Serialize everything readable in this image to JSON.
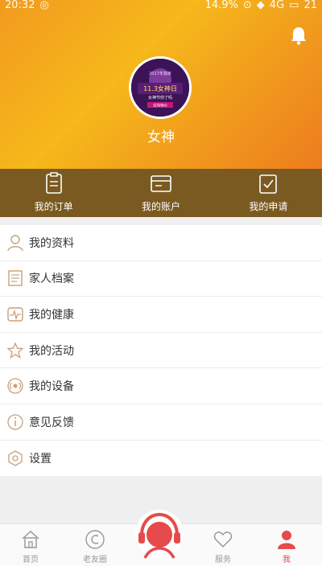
{
  "status_bar": {
    "time": "20:32",
    "battery_text": "14.9%",
    "signal": "4G",
    "level": "21"
  },
  "profile": {
    "name": "女神"
  },
  "avatar_text": {
    "line1": "2017年独家",
    "line2": "11.3女神日",
    "line3": "女神节你了吗",
    "line4": "全场特价"
  },
  "quick_actions": [
    {
      "label": "我的订单"
    },
    {
      "label": "我的账户"
    },
    {
      "label": "我的申请"
    }
  ],
  "menu": [
    {
      "label": "我的资料",
      "icon": "person-icon"
    },
    {
      "label": "家人档案",
      "icon": "document-icon"
    },
    {
      "label": "我的健康",
      "icon": "heartbeat-icon"
    },
    {
      "label": "我的活动",
      "icon": "star-icon"
    },
    {
      "label": "我的设备",
      "icon": "device-icon"
    },
    {
      "label": "意见反馈",
      "icon": "info-icon"
    },
    {
      "label": "设置",
      "icon": "settings-icon"
    }
  ],
  "tabs": [
    {
      "label": "首页"
    },
    {
      "label": "老友圈"
    },
    {
      "label": "服务"
    },
    {
      "label": "我"
    }
  ],
  "colors": {
    "accent": "#e64a4a",
    "header": "#f4aa1c",
    "quickbar": "#7a5a20",
    "icon": "#c9a07a"
  }
}
